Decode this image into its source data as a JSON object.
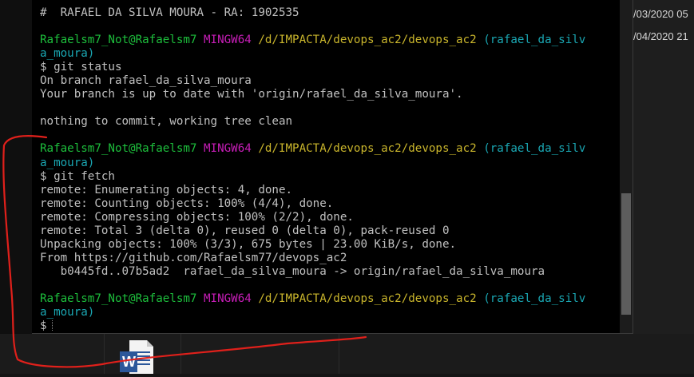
{
  "terminal": {
    "lines": [
      [
        {
          "t": "#  RAFAEL DA SILVA MOURA - RA: 1902535",
          "c": "w"
        }
      ],
      [
        {
          "t": "",
          "c": "w"
        }
      ],
      [
        {
          "t": "Rafaelsm7_Not@Rafaelsm7",
          "c": "green"
        },
        {
          "t": " MINGW64",
          "c": "magenta"
        },
        {
          "t": " /d/IMPACTA/devops_ac2/devops_ac2",
          "c": "yellow"
        },
        {
          "t": " (rafael_da_silv",
          "c": "cyan"
        }
      ],
      [
        {
          "t": "a_moura)",
          "c": "cyan"
        }
      ],
      [
        {
          "t": "$ git status",
          "c": "w"
        }
      ],
      [
        {
          "t": "On branch rafael_da_silva_moura",
          "c": "w"
        }
      ],
      [
        {
          "t": "Your branch is up to date with 'origin/rafael_da_silva_moura'.",
          "c": "w"
        }
      ],
      [
        {
          "t": "",
          "c": "w"
        }
      ],
      [
        {
          "t": "nothing to commit, working tree clean",
          "c": "w"
        }
      ],
      [
        {
          "t": "",
          "c": "w"
        }
      ],
      [
        {
          "t": "Rafaelsm7_Not@Rafaelsm7",
          "c": "green"
        },
        {
          "t": " MINGW64",
          "c": "magenta"
        },
        {
          "t": " /d/IMPACTA/devops_ac2/devops_ac2",
          "c": "yellow"
        },
        {
          "t": " (rafael_da_silv",
          "c": "cyan"
        }
      ],
      [
        {
          "t": "a_moura)",
          "c": "cyan"
        }
      ],
      [
        {
          "t": "$ git fetch",
          "c": "w"
        }
      ],
      [
        {
          "t": "remote: Enumerating objects: 4, done.",
          "c": "w"
        }
      ],
      [
        {
          "t": "remote: Counting objects: 100% (4/4), done.",
          "c": "w"
        }
      ],
      [
        {
          "t": "remote: Compressing objects: 100% (2/2), done.",
          "c": "w"
        }
      ],
      [
        {
          "t": "remote: Total 3 (delta 0), reused 0 (delta 0), pack-reused 0",
          "c": "w"
        }
      ],
      [
        {
          "t": "Unpacking objects: 100% (3/3), 675 bytes | 23.00 KiB/s, done.",
          "c": "w"
        }
      ],
      [
        {
          "t": "From https://github.com/Rafaelsm77/devops_ac2",
          "c": "w"
        }
      ],
      [
        {
          "t": "   b0445fd..07b5ad2  rafael_da_silva_moura -> origin/rafael_da_silva_moura",
          "c": "w"
        }
      ],
      [
        {
          "t": "",
          "c": "w"
        }
      ],
      [
        {
          "t": "Rafaelsm7_Not@Rafaelsm7",
          "c": "green"
        },
        {
          "t": " MINGW64",
          "c": "magenta"
        },
        {
          "t": " /d/IMPACTA/devops_ac2/devops_ac2",
          "c": "yellow"
        },
        {
          "t": " (rafael_da_silv",
          "c": "cyan"
        }
      ],
      [
        {
          "t": "a_moura)",
          "c": "cyan"
        }
      ],
      [
        {
          "t": "$",
          "c": "w"
        }
      ]
    ]
  },
  "file_list": {
    "dates": [
      "/03/2020 05",
      "/04/2020 21"
    ]
  },
  "taskbar": {
    "word_icon_letter": "W"
  },
  "colors": {
    "green": "#1dbf3c",
    "magenta": "#c81eb8",
    "yellow": "#c9b52c",
    "cyan": "#1aa7b3",
    "text": "#c0c0c0",
    "annotation": "#e0201b",
    "word_blue": "#2b579a"
  }
}
